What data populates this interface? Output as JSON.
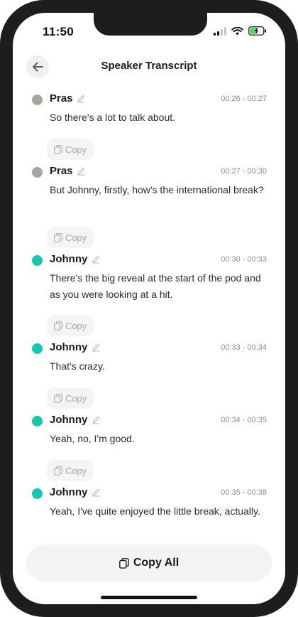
{
  "status": {
    "time": "11:50"
  },
  "header": {
    "title": "Speaker Transcript"
  },
  "copy_label": "Copy",
  "colors": {
    "pras": "#a7a39f",
    "johnny": "#14c9b0"
  },
  "entries": [
    {
      "speaker": "Pras",
      "time": "00:26 - 00:27",
      "text": "So there's a lot to talk about."
    },
    {
      "speaker": "Pras",
      "time": "00:27 - 00:30",
      "text": "But Johnny, firstly, how's the international break?"
    },
    {
      "speaker": "Johnny",
      "time": "00:30 - 00:33",
      "text": "There's the big reveal at the start of the pod and as you were looking at a hit."
    },
    {
      "speaker": "Johnny",
      "time": "00:33 - 00:34",
      "text": "That's crazy."
    },
    {
      "speaker": "Johnny",
      "time": "00:34 - 00:35",
      "text": "Yeah, no, I'm good."
    },
    {
      "speaker": "Johnny",
      "time": "00:35 - 00:38",
      "text": "Yeah, I've quite enjoyed the little break, actually."
    }
  ],
  "footer": {
    "copy_all_label": "Copy All"
  }
}
